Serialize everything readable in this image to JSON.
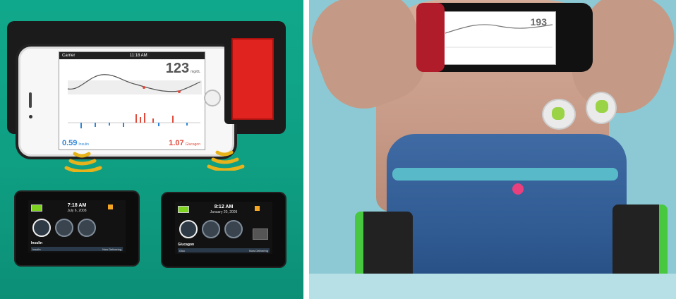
{
  "left_panel": {
    "phone_screen": {
      "carrier": "Carrier",
      "time": "11:18 AM",
      "glucose_value": "123",
      "glucose_unit": "mg/dL",
      "insulin_value": "0.59",
      "insulin_label": "Insulin",
      "glucagon_value": "1.07",
      "glucagon_label": "Glucagon"
    },
    "device_insulin": {
      "time": "7:18 AM",
      "date": "July 6, 2008",
      "label": "Insulin",
      "bar_left": "Insulin",
      "bar_mid": "Now Delivering"
    },
    "device_glucagon": {
      "time": "8:12 AM",
      "date": "January 20, 2009",
      "label": "Glucagon",
      "bar_left": "Gluc",
      "bar_mid": "Now Delivering"
    }
  },
  "right_panel": {
    "phone_reading": "193"
  }
}
